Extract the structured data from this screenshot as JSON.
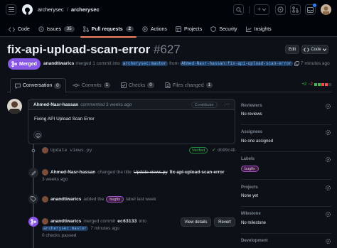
{
  "header": {
    "repo_owner": "archerysec",
    "separator": "/",
    "repo_name": "archerysec",
    "plus_label": "+"
  },
  "repo_tabs": [
    {
      "label": "Code",
      "icon": "code-icon"
    },
    {
      "label": "Issues",
      "icon": "issue-icon",
      "count": "35"
    },
    {
      "label": "Pull requests",
      "icon": "pull-request-icon",
      "count": "2",
      "active": true
    },
    {
      "label": "Actions",
      "icon": "play-icon"
    },
    {
      "label": "Projects",
      "icon": "table-icon"
    },
    {
      "label": "Security",
      "icon": "shield-icon"
    },
    {
      "label": "Insights",
      "icon": "graph-icon"
    }
  ],
  "pr": {
    "title": "fix-api-upload-scan-error",
    "number": "#627",
    "edit_label": "Edit",
    "code_label": "Code",
    "state_label": "Merged",
    "author": "anandtiwarics",
    "merge_text": "merged 1 commit into",
    "base_branch": "archerysec:master",
    "from_text": "from",
    "head_branch": "Ahmed-Nasr-hassan:fix-api-upload-scan-error",
    "time_ago": "7 minutes ago"
  },
  "pr_tabs": [
    {
      "label": "Conversation",
      "count": "0",
      "icon": "comment-icon",
      "active": true
    },
    {
      "label": "Commits",
      "count": "1",
      "icon": "commit-icon"
    },
    {
      "label": "Checks",
      "count": "0",
      "icon": "checks-icon"
    },
    {
      "label": "Files changed",
      "count": "1",
      "icon": "file-diff-icon"
    }
  ],
  "diffstat": {
    "additions": "+2",
    "deletions": "−2"
  },
  "comment": {
    "author": "Ahmed-Nasr-hassan",
    "action": "commented 3 weeks ago",
    "badge": "Contributor",
    "body": "Fixing API Upload Scan Error"
  },
  "timeline": {
    "commit": {
      "message": "Update views.py",
      "verified": "Verified",
      "sha": "db99c4b"
    },
    "rename": {
      "actor": "Ahmed-Nasr-hassan",
      "text": "changed the title",
      "old_title": "Update views.py",
      "new_title": "fix-api-upload-scan-error",
      "time": "3 weeks ago"
    },
    "label": {
      "actor": "anandtiwarics",
      "text": "added the",
      "label": "bugfix",
      "suffix": "label last week"
    },
    "merge": {
      "actor": "anandtiwarics",
      "text": "merged commit",
      "sha": "ec63133",
      "into": "into",
      "branch": "archerysec:master",
      "time": "7 minutes ago",
      "checks": "0 checks passed",
      "view_details": "View details",
      "revert": "Revert"
    }
  },
  "sidebar": {
    "reviewers": {
      "heading": "Reviewers",
      "value": "No reviews"
    },
    "assignees": {
      "heading": "Assignees",
      "value": "No one assigned"
    },
    "labels": {
      "heading": "Labels",
      "value": "bugfix"
    },
    "projects": {
      "heading": "Projects",
      "value": "None yet"
    },
    "milestone": {
      "heading": "Milestone",
      "value": "No milestone"
    },
    "development": {
      "heading": "Development"
    }
  },
  "colors": {
    "merged": "#8957e5",
    "accent_underline": "#f78166",
    "additions": "#3fb950",
    "deletions": "#f85149",
    "bg": "#0d1117"
  }
}
